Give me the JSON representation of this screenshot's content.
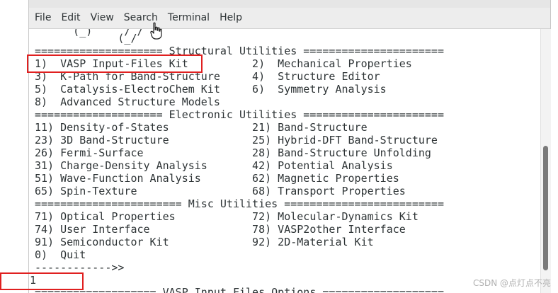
{
  "menu": {
    "items": [
      "File",
      "Edit",
      "View",
      "Search",
      "Terminal",
      "Help"
    ]
  },
  "terminal": {
    "lines": [
      "      (_)     / /",
      "             (_/",
      "==================== Structural Utilities ======================",
      "1)  VASP Input-Files Kit          2)  Mechanical Properties",
      "3)  K-Path for Band-Structure     4)  Structure Editor",
      "5)  Catalysis-ElectroChem Kit     6)  Symmetry Analysis",
      "8)  Advanced Structure Models",
      "==================== Electronic Utilities ======================",
      "11) Density-of-States             21) Band-Structure",
      "23) 3D Band-Structure             25) Hybrid-DFT Band-Structure",
      "26) Fermi-Surface                 28) Band-Structure Unfolding",
      "31) Charge-Density Analysis       42) Potential Analysis",
      "51) Wave-Function Analysis        62) Magnetic Properties",
      "65) Spin-Texture                  68) Transport Properties",
      "======================= Misc Utilities =========================",
      "71) Optical Properties            72) Molecular-Dynamics Kit",
      "74) User Interface                78) VASP2other Interface",
      "91) Semiconductor Kit             92) 2D-Material Kit",
      "0)  Quit",
      "------------>>"
    ],
    "input_value": "1",
    "next_line": "=================== VASP Input Files Options ==================="
  },
  "watermark": "CSDN @点灯点不亮",
  "colors": {
    "highlight": "#e02020",
    "text": "#2e3436",
    "menubar": "#ededed"
  },
  "icons": {
    "cursor": "hand-pointer-icon"
  }
}
